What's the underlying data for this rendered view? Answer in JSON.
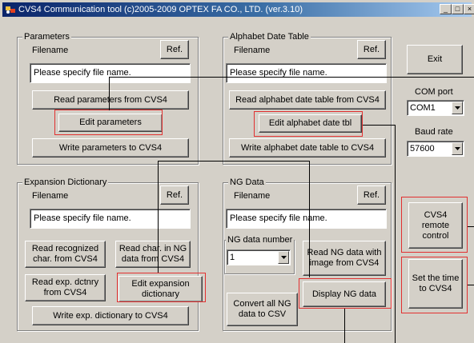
{
  "window": {
    "title": "CVS4 Communication tool (c)2005-2009 OPTEX FA CO., LTD. (ver.3.10)",
    "minimize_glyph": "_",
    "maximize_glyph": "□",
    "close_glyph": "×"
  },
  "parameters": {
    "legend": "Parameters",
    "filename_label": "Filename",
    "ref_label": "Ref.",
    "filename_value": "Please specify file name.",
    "read_label": "Read parameters from CVS4",
    "edit_label": "Edit parameters",
    "write_label": "Write parameters to CVS4"
  },
  "alphabet": {
    "legend": "Alphabet Date Table",
    "filename_label": "Filename",
    "ref_label": "Ref.",
    "filename_value": "Please specify file name.",
    "read_label": "Read alphabet date table from CVS4",
    "edit_label": "Edit alphabet date tbl",
    "write_label": "Write alphabet date table to CVS4"
  },
  "expansion": {
    "legend": "Expansion Dictionary",
    "filename_label": "Filename",
    "ref_label": "Ref.",
    "filename_value": "Please specify file name.",
    "read_recognized_label": "Read recognized char. from CVS4",
    "read_ng_char_label": "Read char. in NG data from CVS4",
    "read_exp_label": "Read exp. dctnry from CVS4",
    "edit_exp_label": "Edit expansion dictionary",
    "write_exp_label": "Write exp. dictionary to CVS4"
  },
  "ng": {
    "legend": "NG Data",
    "filename_label": "Filename",
    "ref_label": "Ref.",
    "filename_value": "Please specify file name.",
    "number_legend": "NG data number",
    "number_value": "1",
    "read_with_image_label": "Read NG data with image from CVS4",
    "convert_label": "Convert all NG data to CSV",
    "display_label": "Display NG data"
  },
  "side": {
    "exit_label": "Exit",
    "com_port_label": "COM port",
    "com_port_value": "COM1",
    "baud_rate_label": "Baud rate",
    "baud_rate_value": "57600",
    "remote_label": "CVS4 remote control",
    "set_time_label": "Set the time to CVS4"
  },
  "icons": {
    "title_icon": "app-icon",
    "dropdown": "chevron-down-icon"
  },
  "colors": {
    "highlight": "#e23030",
    "titlebar": "#0a246a",
    "face": "#d4d0c8"
  }
}
